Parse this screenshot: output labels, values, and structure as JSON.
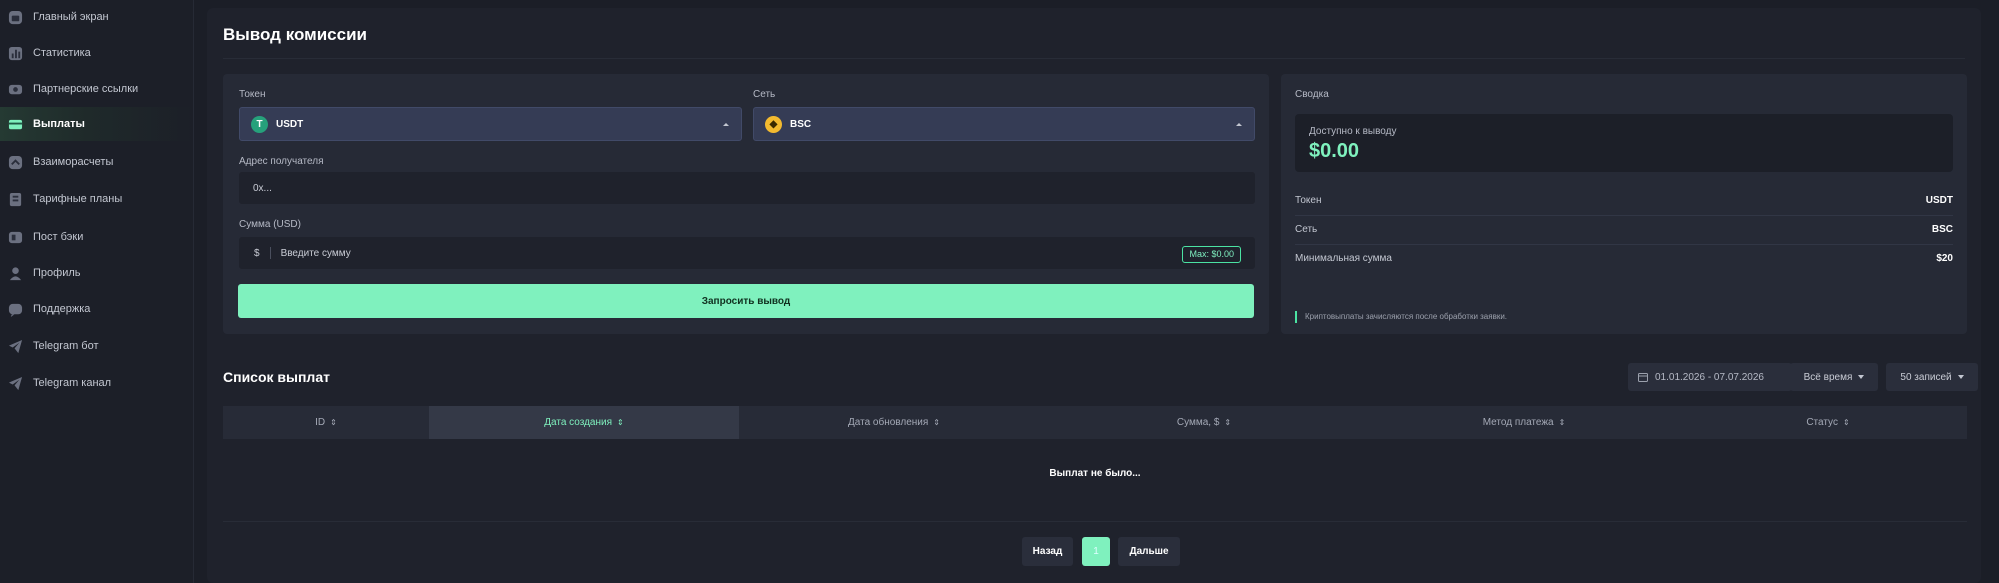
{
  "sidebar": {
    "items": [
      {
        "label": "Главный экран",
        "icon": "home-icon"
      },
      {
        "label": "Статистика",
        "icon": "chart-icon"
      },
      {
        "label": "Партнерские ссылки",
        "icon": "link-icon"
      },
      {
        "label": "Выплаты",
        "icon": "wallet-icon",
        "active": true
      },
      {
        "label": "Взаиморасчеты",
        "icon": "settlement-icon"
      },
      {
        "label": "Тарифные планы",
        "icon": "plans-icon"
      },
      {
        "label": "Пост бэки",
        "icon": "postback-icon"
      },
      {
        "label": "Профиль",
        "icon": "user-icon"
      },
      {
        "label": "Поддержка",
        "icon": "support-icon"
      },
      {
        "label": "Telegram бот",
        "icon": "telegram-icon"
      },
      {
        "label": "Telegram канал",
        "icon": "telegram-icon"
      }
    ]
  },
  "page": {
    "title": "Вывод комиссии"
  },
  "form": {
    "token_label": "Токен",
    "token_value": "USDT",
    "network_label": "Сеть",
    "network_value": "BSC",
    "address_label": "Адрес получателя",
    "address_placeholder": "0x...",
    "amount_label": "Сумма (USD)",
    "amount_prefix": "$",
    "amount_placeholder": "Введите сумму",
    "max_badge": "Max: $0.00",
    "submit_label": "Запросить вывод"
  },
  "summary": {
    "title": "Сводка",
    "available_label": "Доступно к выводу",
    "available_value": "$0.00",
    "rows": [
      {
        "key": "Токен",
        "value": "USDT"
      },
      {
        "key": "Сеть",
        "value": "BSC"
      },
      {
        "key": "Минимальная сумма",
        "value": "$20"
      }
    ],
    "note": "Криптовыплаты зачисляются после обработки заявки."
  },
  "payouts": {
    "title": "Список выплат",
    "date_range": "01.01.2026 - 07.07.2026",
    "period": "Всё время",
    "page_size": "50 записей",
    "columns": [
      "ID",
      "Дата создания",
      "Дата обновления",
      "Сумма, $",
      "Метод платежа",
      "Статус"
    ],
    "active_column": "Дата создания",
    "empty_text": "Выплат не было...",
    "pagination": {
      "prev": "Назад",
      "current": "1",
      "next": "Дальше"
    }
  },
  "colors": {
    "accent": "#7ff1be",
    "background": "#1b1e27",
    "card": "#262a36"
  }
}
